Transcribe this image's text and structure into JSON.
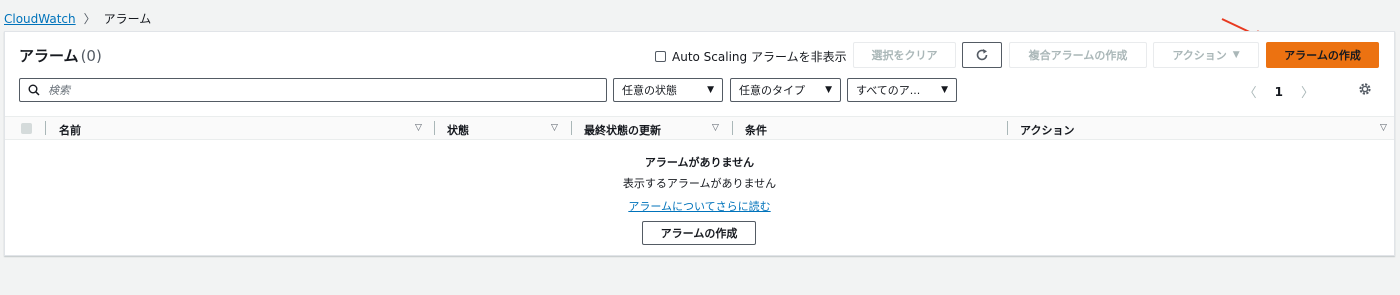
{
  "breadcrumb": {
    "root": "CloudWatch",
    "current": "アラーム"
  },
  "header": {
    "title": "アラーム",
    "count": "(0)"
  },
  "toolbar": {
    "autoscaling_label": "Auto Scaling アラームを非表示",
    "clear_selection": "選択をクリア",
    "create_composite": "複合アラームの作成",
    "actions": "アクション",
    "create_alarm": "アラームの作成"
  },
  "search": {
    "placeholder": "検索"
  },
  "filters": {
    "state": "任意の状態",
    "type": "任意のタイプ",
    "all": "すべてのア..."
  },
  "pagination": {
    "page": "1"
  },
  "table": {
    "columns": [
      "名前",
      "状態",
      "最終状態の更新",
      "条件",
      "アクション"
    ]
  },
  "empty": {
    "title": "アラームがありません",
    "subtitle": "表示するアラームがありません",
    "link": "アラームについてさらに読む",
    "button": "アラームの作成"
  },
  "colors": {
    "primary": "#ec7211",
    "link": "#0073bb",
    "annotation": "#e8391f"
  }
}
